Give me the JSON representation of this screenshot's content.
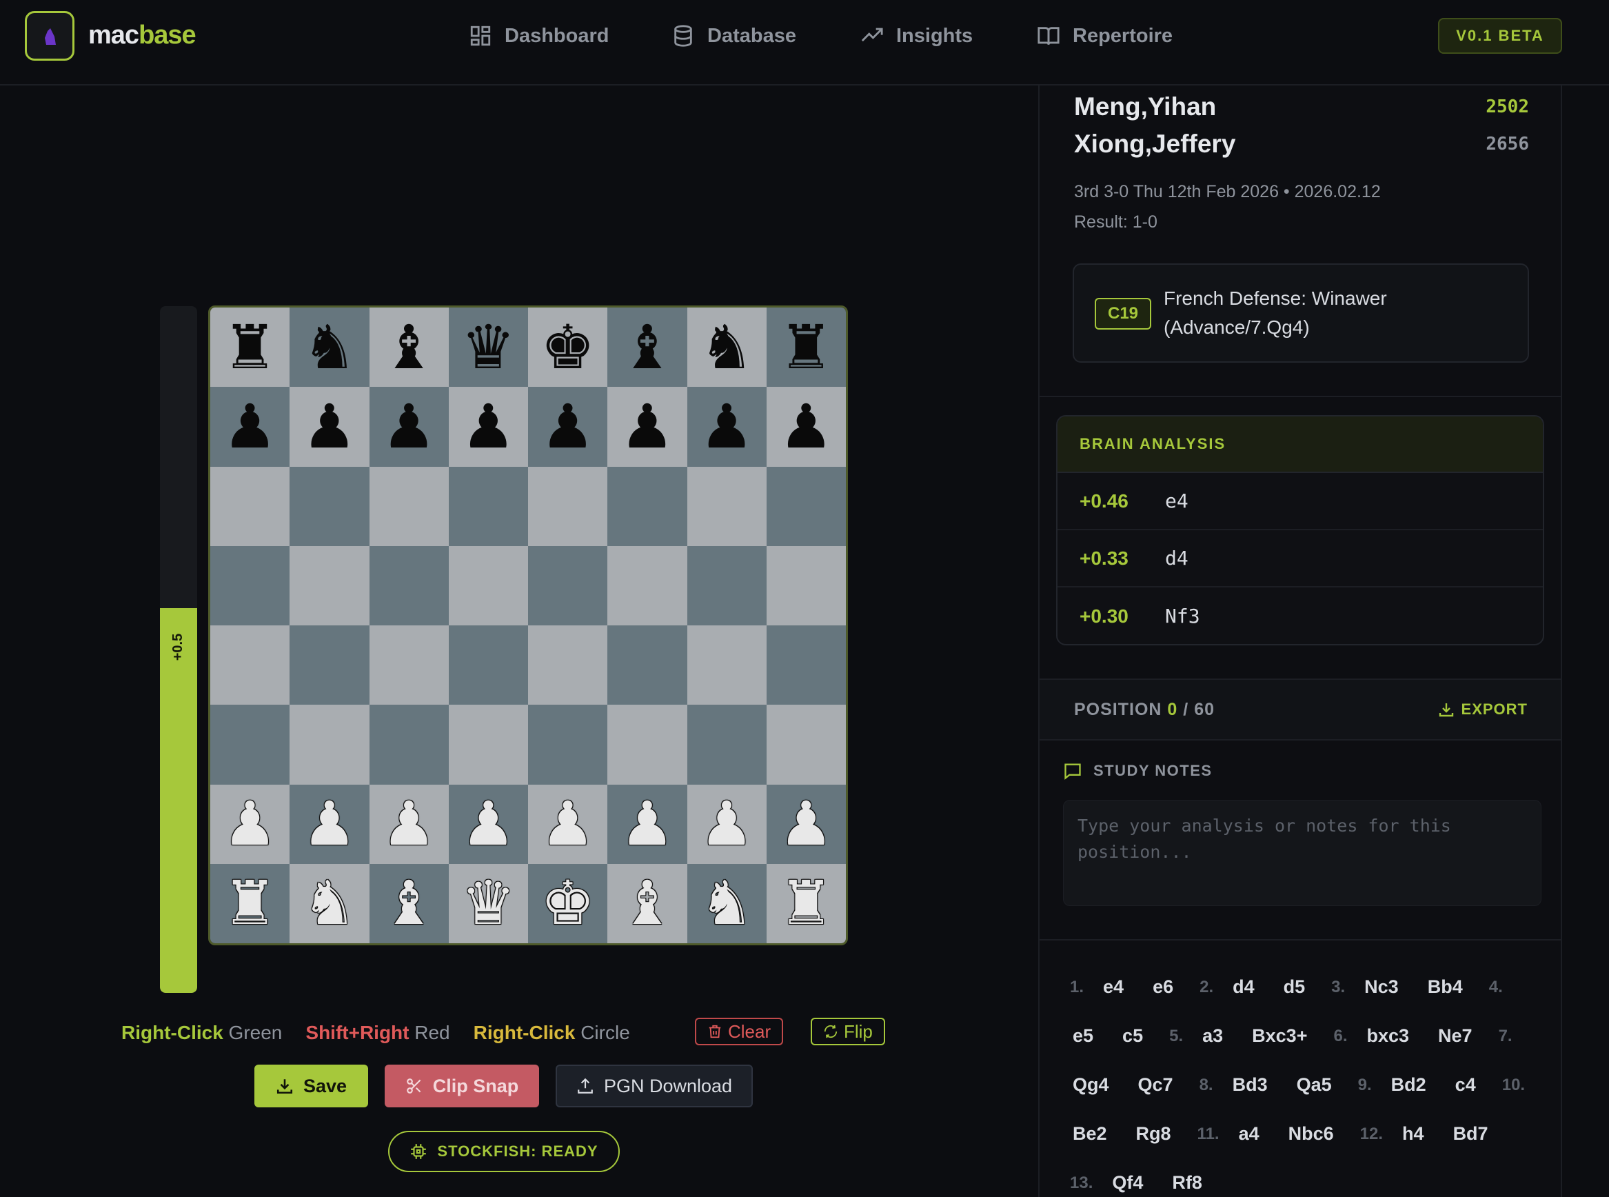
{
  "app": {
    "logo_part1": "mac",
    "logo_part2": "base",
    "version_badge": "V0.1 BETA",
    "accent": "#a6c83b"
  },
  "nav": [
    {
      "label": "Dashboard",
      "icon": "grid-icon"
    },
    {
      "label": "Database",
      "icon": "database-icon"
    },
    {
      "label": "Insights",
      "icon": "trend-icon"
    },
    {
      "label": "Repertoire",
      "icon": "book-icon"
    }
  ],
  "game": {
    "white": "Meng,Yihan",
    "white_elo": "2502",
    "black": "Xiong,Jeffery",
    "black_elo": "2656",
    "event_line": "3rd 3-0 Thu 12th Feb 2026 • 2026.02.12",
    "result_line": "Result: 1-0",
    "eco": "C19",
    "opening": "French Defense: Winawer (Advance/7.Qg4)"
  },
  "eval": {
    "label": "+0.5",
    "white_fraction": 0.56
  },
  "board": {
    "rows": [
      [
        "♜",
        "♞",
        "♝",
        "♛",
        "♚",
        "♝",
        "♞",
        "♜"
      ],
      [
        "♟",
        "♟",
        "♟",
        "♟",
        "♟",
        "♟",
        "♟",
        "♟"
      ],
      [
        "",
        "",
        "",
        "",
        "",
        "",
        "",
        ""
      ],
      [
        "",
        "",
        "",
        "",
        "",
        "",
        "",
        ""
      ],
      [
        "",
        "",
        "",
        "",
        "",
        "",
        "",
        ""
      ],
      [
        "",
        "",
        "",
        "",
        "",
        "",
        "",
        ""
      ],
      [
        "♟",
        "♟",
        "♟",
        "♟",
        "♟",
        "♟",
        "♟",
        "♟"
      ],
      [
        "♜",
        "♞",
        "♝",
        "♛",
        "♚",
        "♝",
        "♞",
        "♜"
      ]
    ]
  },
  "hints": {
    "h1_key": "Right-Click",
    "h1_text": " Green",
    "h2_key": "Shift+Right",
    "h2_text": " Red",
    "h3_key": "Right-Click",
    "h3_text": " Circle"
  },
  "controls": {
    "clear": "Clear",
    "flip": "Flip",
    "save": "Save",
    "clip": "Clip Snap",
    "pgn": "PGN Download",
    "engine": "STOCKFISH: READY"
  },
  "analysis": {
    "title": "BRAIN ANALYSIS",
    "lines": [
      {
        "score": "+0.46",
        "move": "e4"
      },
      {
        "score": "+0.33",
        "move": "d4"
      },
      {
        "score": "+0.30",
        "move": "Nf3"
      }
    ]
  },
  "position": {
    "label": "POSITION",
    "current": "0",
    "sep": "/",
    "total": "60",
    "export": "EXPORT"
  },
  "notes": {
    "title": "STUDY NOTES",
    "placeholder": "Type your analysis or notes for this position..."
  },
  "moves": [
    "1.",
    "e4",
    "e6",
    "2.",
    "d4",
    "d5",
    "3.",
    "Nc3",
    "Bb4",
    "4.",
    "e5",
    "c5",
    "5.",
    "a3",
    "Bxc3+",
    "6.",
    "bxc3",
    "Ne7",
    "7.",
    "Qg4",
    "Qc7",
    "8.",
    "Bd3",
    "Qa5",
    "9.",
    "Bd2",
    "c4",
    "10.",
    "Be2",
    "Rg8",
    "11.",
    "a4",
    "Nbc6",
    "12.",
    "h4",
    "Bd7",
    "13.",
    "Qf4",
    "Rf8"
  ]
}
